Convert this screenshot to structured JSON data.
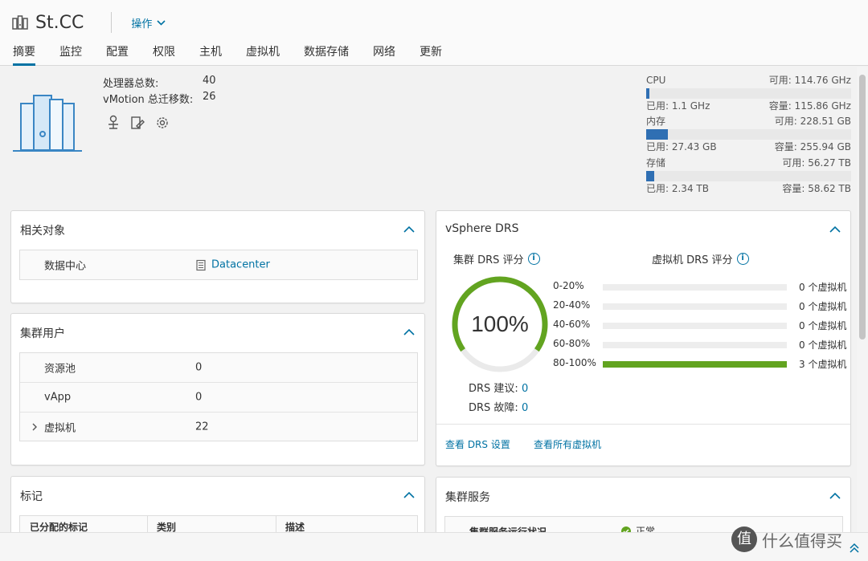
{
  "header": {
    "title": "St.CC",
    "actions_label": "操作",
    "tabs": [
      "摘要",
      "监控",
      "配置",
      "权限",
      "主机",
      "虚拟机",
      "数据存储",
      "网络",
      "更新"
    ]
  },
  "summary": {
    "stats": [
      {
        "label": "处理器总数:",
        "value": "40"
      },
      {
        "label": "vMotion 总迁移数:",
        "value": "26"
      }
    ],
    "resources": [
      {
        "name": "CPU",
        "free": "可用: 114.76 GHz",
        "used": "已用: 1.1 GHz",
        "capacity": "容量: 115.86 GHz",
        "usage_fraction": 0.01
      },
      {
        "name": "内存",
        "free": "可用: 228.51 GB",
        "used": "已用: 27.43 GB",
        "capacity": "容量: 255.94 GB",
        "usage_fraction": 0.107
      },
      {
        "name": "存储",
        "free": "可用: 56.27 TB",
        "used": "已用: 2.34 TB",
        "capacity": "容量: 58.62 TB",
        "usage_fraction": 0.04
      }
    ]
  },
  "related": {
    "title": "相关对象",
    "row_label": "数据中心",
    "row_value": "Datacenter"
  },
  "cluster_users": {
    "title": "集群用户",
    "rows": [
      {
        "label": "资源池",
        "value": "0"
      },
      {
        "label": "vApp",
        "value": "0"
      },
      {
        "label": "虚拟机",
        "value": "22"
      }
    ]
  },
  "tags": {
    "title": "标记",
    "columns": [
      "已分配的标记",
      "类别",
      "描述"
    ]
  },
  "drs": {
    "title": "vSphere DRS",
    "cluster_score_label": "集群 DRS 评分",
    "vm_score_label": "虚拟机 DRS 评分",
    "score": "100%",
    "score_fraction": 1.0,
    "histogram": [
      {
        "range": "0-20%",
        "count": "0 个虚拟机",
        "fraction": 0
      },
      {
        "range": "20-40%",
        "count": "0 个虚拟机",
        "fraction": 0
      },
      {
        "range": "40-60%",
        "count": "0 个虚拟机",
        "fraction": 0
      },
      {
        "range": "60-80%",
        "count": "0 个虚拟机",
        "fraction": 0
      },
      {
        "range": "80-100%",
        "count": "3 个虚拟机",
        "fraction": 1
      }
    ],
    "recommendations_label": "DRS 建议:",
    "recommendations_value": "0",
    "faults_label": "DRS 故障:",
    "faults_value": "0",
    "link_settings": "查看 DRS 设置",
    "link_all_vms": "查看所有虚拟机"
  },
  "services": {
    "title": "集群服务",
    "row_label": "集群服务运行状况",
    "row_value": "正常"
  },
  "watermark": {
    "logo": "值",
    "text": "什么值得买"
  },
  "colors": {
    "accent": "#0072a3",
    "bar_blue": "#2f6fb3",
    "green": "#62a420"
  }
}
